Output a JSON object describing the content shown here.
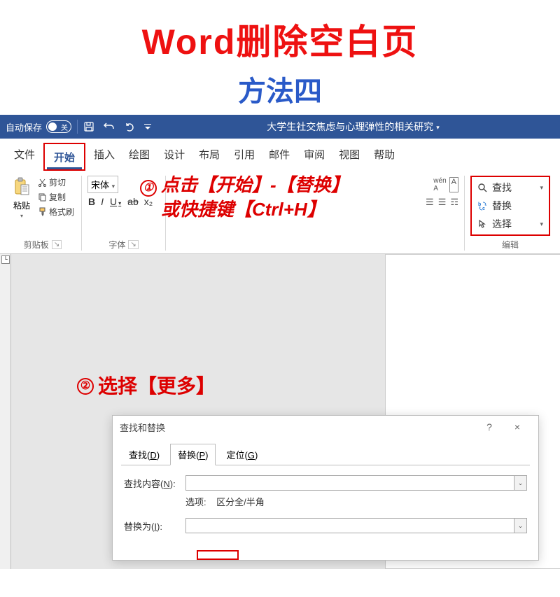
{
  "hero": {
    "title": "Word删除空白页",
    "subtitle": "方法四"
  },
  "titlebar": {
    "autosave": "自动保存",
    "off": "关",
    "doc": "大学生社交焦虑与心理弹性的相关研究"
  },
  "tabs": {
    "file": "文件",
    "home": "开始",
    "insert": "插入",
    "draw": "绘图",
    "design": "设计",
    "layout": "布局",
    "ref": "引用",
    "mail": "邮件",
    "review": "审阅",
    "view": "视图",
    "help": "帮助"
  },
  "clipboard": {
    "paste": "粘贴",
    "cut": "剪切",
    "copy": "复制",
    "fmt": "格式刷",
    "group": "剪贴板"
  },
  "font": {
    "family": "宋体",
    "group": "字体",
    "ruby": "wén",
    "bold": "B",
    "italic": "I",
    "underline": "U",
    "strike": "ab",
    "sub": "x₂",
    "charA": "A"
  },
  "edit": {
    "find": "查找",
    "replace": "替换",
    "select": "选择",
    "group": "编辑"
  },
  "annot": {
    "step1a": "点击【开始】-【替换】",
    "step1b": "或快捷键【Ctrl+H】",
    "step2": "选择【更多】",
    "m1": "①",
    "m2": "②"
  },
  "dialog": {
    "title": "查找和替换",
    "tab_find": "查找",
    "tab_find_u": "D",
    "tab_rep": "替换",
    "tab_rep_u": "P",
    "tab_goto": "定位",
    "tab_goto_u": "G",
    "find_label": "查找内容",
    "find_u": "N",
    "opt_label": "选项:",
    "opt_val": "区分全/半角",
    "rep_label": "替换为",
    "rep_u": "I",
    "help": "?",
    "close": "×"
  }
}
